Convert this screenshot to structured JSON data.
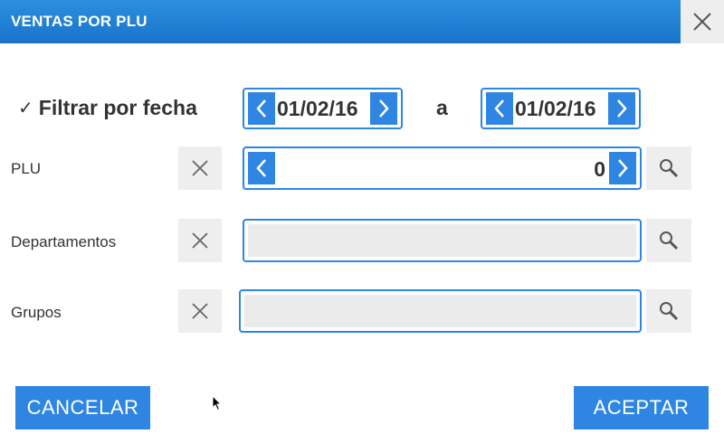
{
  "dialog": {
    "title": "VENTAS POR PLU"
  },
  "date_filter": {
    "label": "Filtrar por fecha",
    "checked": true,
    "check_glyph": "✓",
    "from_value": "01/02/16",
    "separator": "a",
    "to_value": "01/02/16"
  },
  "plu": {
    "label": "PLU",
    "value": "0"
  },
  "departamentos": {
    "label": "Departamentos",
    "value": ""
  },
  "grupos": {
    "label": "Grupos",
    "value": ""
  },
  "buttons": {
    "cancel": "CANCELAR",
    "accept": "ACEPTAR"
  },
  "colors": {
    "accent": "#2f86e2",
    "title_bar": "#1a73c8",
    "button_gray": "#eeeeee",
    "field_gray": "#ebebeb"
  },
  "icons": [
    "close-icon",
    "chevron-left-icon",
    "chevron-right-icon",
    "clear-icon",
    "search-icon"
  ]
}
